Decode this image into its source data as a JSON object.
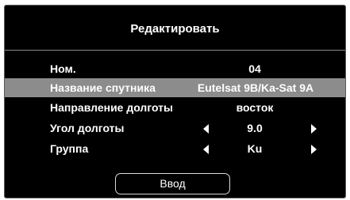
{
  "dialog": {
    "title": "Редактировать",
    "rows": [
      {
        "label": "Ном.",
        "value": "04"
      },
      {
        "label": "Название спутника",
        "value": "Eutelsat 9B/Ka-Sat 9A",
        "selected": true
      },
      {
        "label": "Направление долготы",
        "value": "восток"
      },
      {
        "label": "Угол долготы",
        "value": "9.0"
      },
      {
        "label": "Группа",
        "value": "Ku"
      }
    ],
    "enter_label": "Ввод"
  },
  "colors": {
    "background": "#000000",
    "selected_row": "#8c8c8c",
    "text": "#ffffff"
  }
}
